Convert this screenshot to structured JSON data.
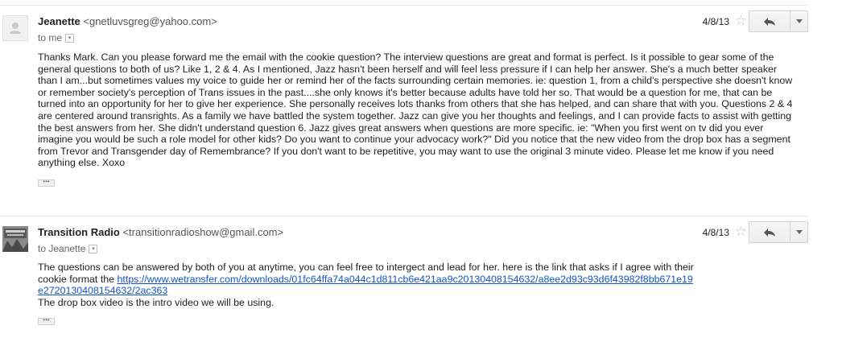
{
  "messages": [
    {
      "sender_name": "Jeanette",
      "sender_email": "<gnetluvsgreg@yahoo.com>",
      "recipient": "to me",
      "date": "4/8/13",
      "body": "Thanks Mark. Can you please forward me the email with the cookie question? The interview questions are great and format is perfect. Is it possible to gear some of the general questions to both of us? Like  1, 2 & 4. As I mentioned, Jazz hasn't been herself and will feel less pressure if I can help her answer. She's a much better speaker than I am...but sometimes values my voice to guide her or remind her of the facts surrounding certain memories. ie: question 1, from a child's perspective she doesn't know or remember society's perception of Trans issues in the past....she only knows it's better because adults have told her so. That would be a question for me, that can be turned into an opportunity for her to give her experience. She personally receives lots thanks from others that she has helped, and can share that with you. Questions 2 & 4 are centered around transrights. As a family we have battled the system together. Jazz can give you her thoughts and feelings, and I can provide facts to assist with getting the best answers from her. She didn't understand question 6. Jazz gives great answers when questions are more specific. ie: \"When you first went on tv did you ever imagine you would be such a role model for other kids? Do you want to continue your advocacy work?\" Did you notice that the new video from the drop box has a segment from Trevor and Transgender day of Remembrance? If you don't want to be repetitive, you may want to use the original 3 minute video. Please let me know if you need anything else. Xoxo"
    },
    {
      "sender_name": "Transition Radio",
      "sender_email": "<transitionradioshow@gmail.com>",
      "recipient": "to Jeanette",
      "date": "4/8/13",
      "body_before_link": "The questions can be answered by both of you at anytime, you can feel free to intergect and lead for her. here is the link that asks if I agree with their cookie format the ",
      "link": "https://www.wetransfer.com/downloads/01fc64ffa74a044c1d811cb6e421aa9c20130408154632/a8ee2d93c93d6f43982f8bb671e19e2720130408154632/2ac363",
      "body_after_link": "The drop box video is the intro video we will be using."
    }
  ],
  "icons": {
    "star": "☆",
    "more_caret": "▾",
    "ellipsis": "•••"
  }
}
